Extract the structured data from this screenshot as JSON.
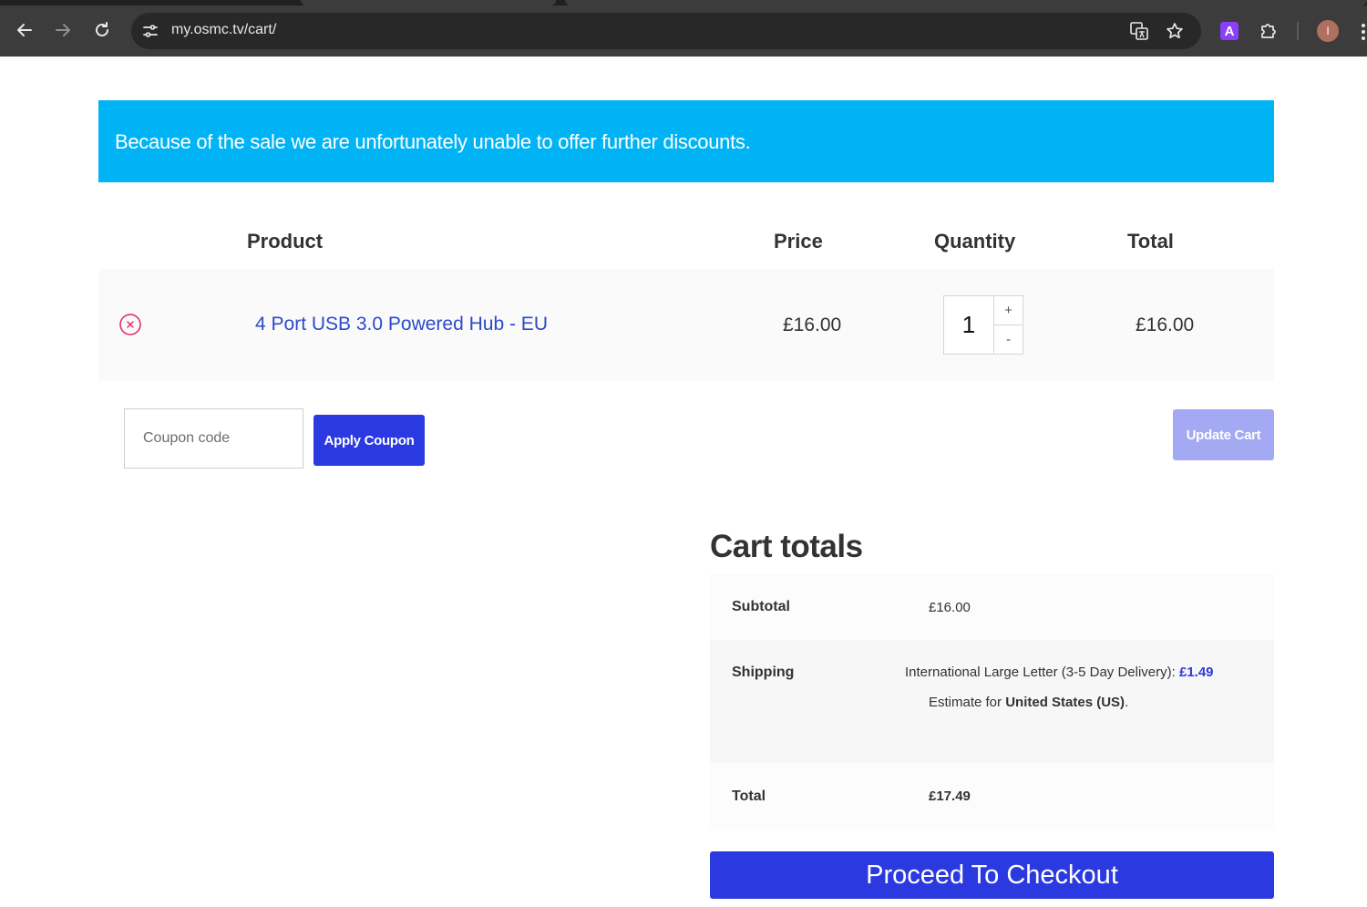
{
  "browser": {
    "url": "my.osmc.tv/cart/",
    "avatar_initial": "I",
    "extension_letter": "A"
  },
  "notice": {
    "message": "Because of the sale we are unfortunately unable to offer further discounts.",
    "color": "#00b3f5"
  },
  "table": {
    "headers": {
      "product": "Product",
      "price": "Price",
      "quantity": "Quantity",
      "total": "Total"
    },
    "rows": [
      {
        "product": "4 Port USB 3.0 Powered Hub - EU",
        "price": "£16.00",
        "quantity": "1",
        "total": "£16.00"
      }
    ],
    "qty_plus": "+",
    "qty_minus": "-"
  },
  "coupon": {
    "placeholder": "Coupon code",
    "value": "",
    "apply_label": "Apply Coupon"
  },
  "update_cart_label": "Update Cart",
  "cart_totals": {
    "title": "Cart totals",
    "subtotal_label": "Subtotal",
    "subtotal_value": "£16.00",
    "shipping_label": "Shipping",
    "shipping_method": "International Large Letter (3-5 Day Delivery): ",
    "shipping_amount": "£1.49",
    "estimate_prefix": "Estimate for ",
    "estimate_country": "United States (US)",
    "estimate_suffix": ".",
    "total_label": "Total",
    "total_value": "£17.49"
  },
  "checkout_label": "Proceed To Checkout",
  "colors": {
    "accent": "#2b3ae0",
    "accent_disabled": "#a3a9f2",
    "remove": "#e0245e",
    "link": "#2b4acb"
  }
}
